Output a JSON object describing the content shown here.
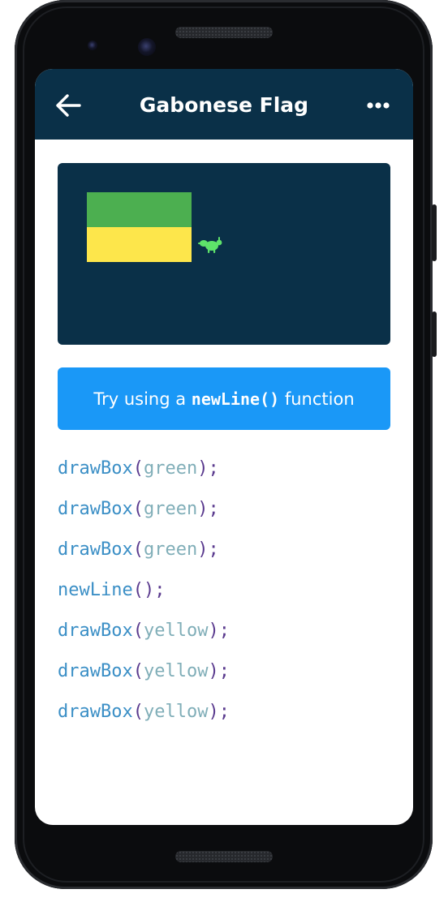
{
  "header": {
    "title": "Gabonese Flag",
    "back_icon": "arrow-left-icon",
    "more_icon": "more-horizontal-icon"
  },
  "canvas": {
    "background_color": "#0a3048",
    "boxes": [
      {
        "color_name": "green",
        "color": "#4caf50"
      },
      {
        "color_name": "yellow",
        "color": "#fde64b"
      }
    ],
    "character_icon": "bug-icon",
    "character_color": "#5ee36a"
  },
  "hint": {
    "prefix": "Try using a",
    "code": "newLine()",
    "suffix": "function",
    "background_color": "#1a98f7"
  },
  "code_colors": {
    "function": "#3b8fc6",
    "paren": "#5a3a8e",
    "argument": "#80aeb8"
  },
  "code_lines": [
    {
      "fn": "drawBox",
      "open": "(",
      "arg": "green",
      "close": ");"
    },
    {
      "fn": "drawBox",
      "open": "(",
      "arg": "green",
      "close": ");"
    },
    {
      "fn": "drawBox",
      "open": "(",
      "arg": "green",
      "close": ");"
    },
    {
      "fn": "newLine",
      "open": "(",
      "arg": "",
      "close": ");"
    },
    {
      "fn": "drawBox",
      "open": "(",
      "arg": "yellow",
      "close": ");"
    },
    {
      "fn": "drawBox",
      "open": "(",
      "arg": "yellow",
      "close": ");"
    },
    {
      "fn": "drawBox",
      "open": "(",
      "arg": "yellow",
      "close": ");"
    }
  ]
}
